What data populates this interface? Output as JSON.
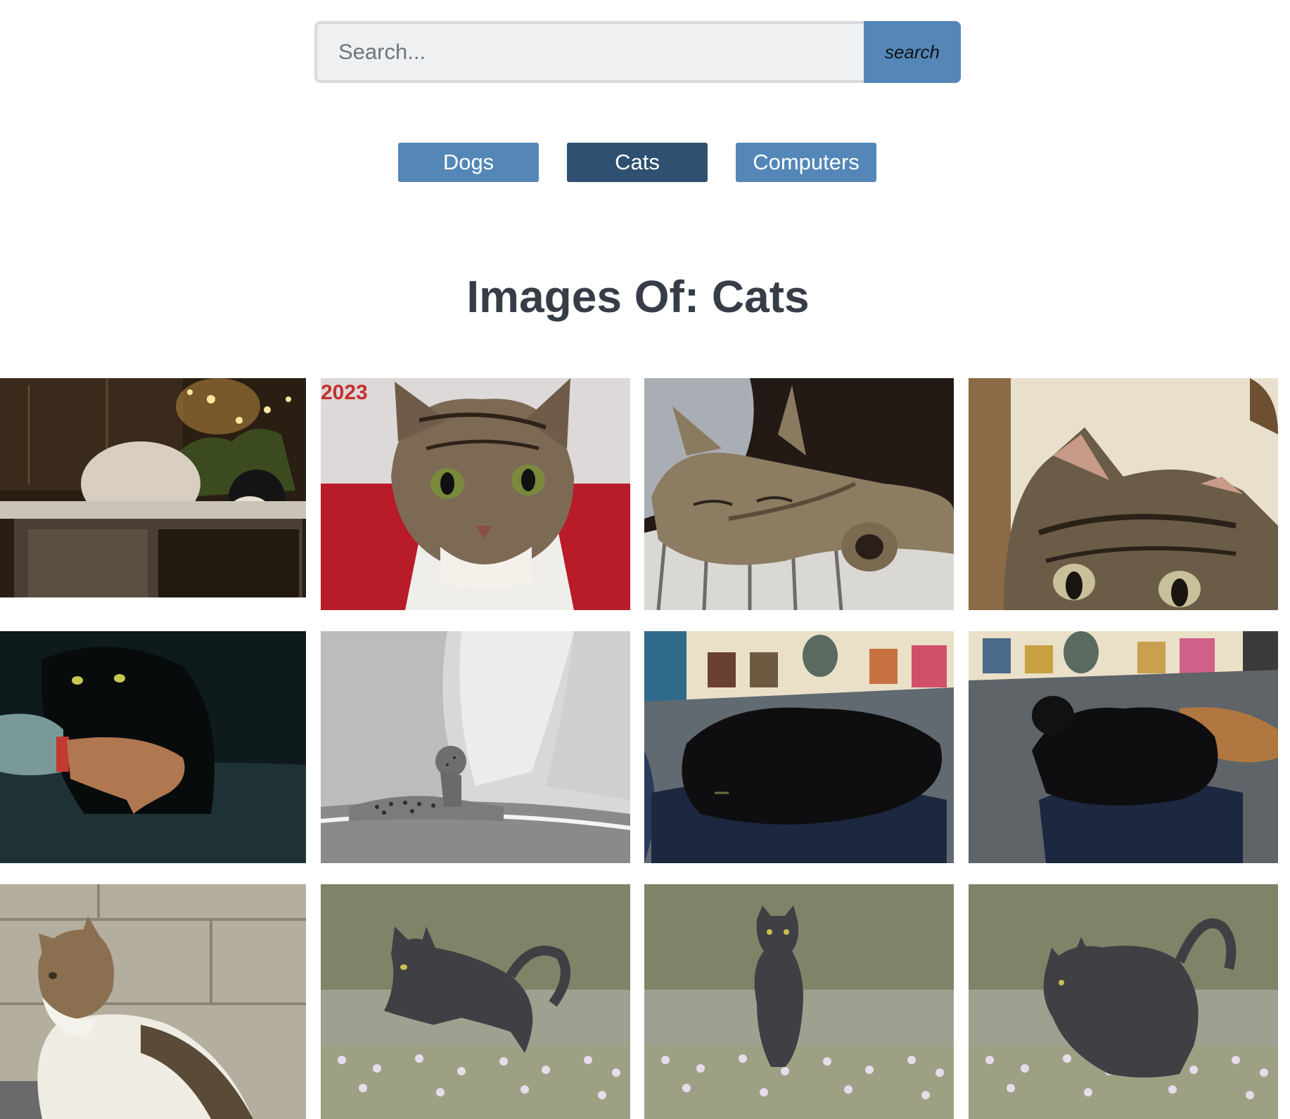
{
  "search": {
    "placeholder": "Search...",
    "value": "",
    "button_label": "search"
  },
  "categories": [
    {
      "label": "Dogs",
      "active": false
    },
    {
      "label": "Cats",
      "active": true
    },
    {
      "label": "Computers",
      "active": false
    }
  ],
  "heading": {
    "prefix": "Images Of:",
    "category": "Cats",
    "text": "Images Of: Cats"
  },
  "colors": {
    "button": "#5487b8",
    "button_active": "#2f5070",
    "heading": "#363d47",
    "search_bg": "#eef0f2"
  },
  "gallery": {
    "images": [
      {
        "subject": "white-cat-and-black-cat-by-window-with-lights"
      },
      {
        "subject": "tabby-cat-portrait-red-background",
        "overlay_text": "2023"
      },
      {
        "subject": "sleeping-tabby-kitten-on-pillow"
      },
      {
        "subject": "tabby-cat-peeking"
      },
      {
        "subject": "black-cat-with-hand"
      },
      {
        "subject": "leopard-on-rocks-black-and-white"
      },
      {
        "subject": "black-cat-curled-on-backpack"
      },
      {
        "subject": "black-cat-sitting-on-backpack"
      },
      {
        "subject": "tabby-and-white-cat-by-stone-wall"
      },
      {
        "subject": "gray-cat-leaping-in-meadow"
      },
      {
        "subject": "gray-cat-running-toward-camera"
      },
      {
        "subject": "gray-cat-running-in-flowers"
      }
    ]
  }
}
